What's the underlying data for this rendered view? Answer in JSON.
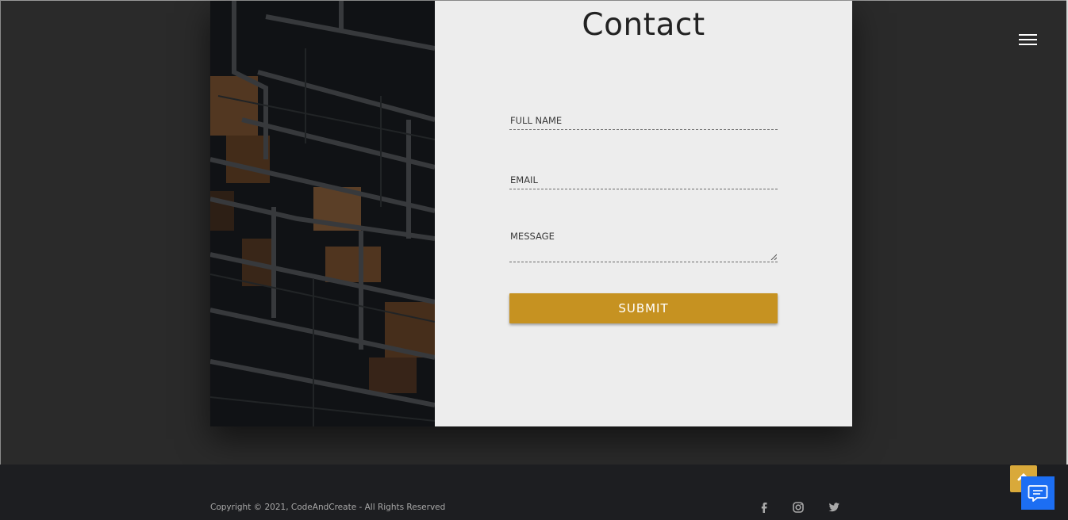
{
  "page": {
    "title": "Contact"
  },
  "form": {
    "full_name_label": "FULL NAME",
    "email_label": "EMAIL",
    "message_label": "MESSAGE",
    "submit_label": "SUBMIT"
  },
  "footer": {
    "copyright": "Copyright © 2021, CodeAndCreate - All Rights Reserved",
    "social": [
      "facebook-icon",
      "instagram-icon",
      "twitter-icon"
    ]
  },
  "icons": {
    "menu": "hamburger-menu-icon",
    "scroll_top": "chevron-up-icon",
    "chat": "chat-icon"
  },
  "colors": {
    "background": "#2a2a2a",
    "panel": "#ededed",
    "accent": "#c69221",
    "footer": "#1d1e21",
    "chat": "#1c6ef3"
  }
}
